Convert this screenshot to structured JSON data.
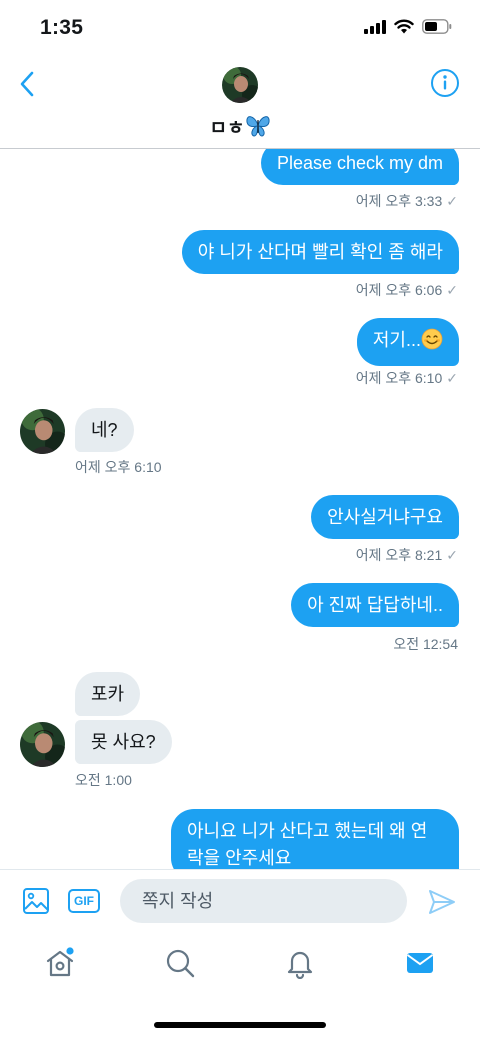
{
  "status_bar": {
    "time": "1:35"
  },
  "header": {
    "name_text": "ㅁㅎ",
    "avatar_icon": "profile-avatar",
    "back_icon": "chevron-left-icon",
    "info_icon": "info-icon"
  },
  "messages": [
    {
      "direction": "out",
      "text": "Please check my dm",
      "time": "어제 오후 3:33"
    },
    {
      "direction": "out",
      "text": "야 니가 산다며 빨리 확인 좀 해라",
      "time": "어제 오후 6:06"
    },
    {
      "direction": "out",
      "text": "저기...",
      "time": "어제 오후 6:10",
      "emoji": "smiling-face"
    },
    {
      "direction": "in",
      "text": "네?",
      "time": "어제 오후 6:10"
    },
    {
      "direction": "out",
      "text": "안사실거냐구요",
      "time": "어제 오후 8:21"
    },
    {
      "direction": "out",
      "text": "아 진짜 답답하네..",
      "time": "오전 12:54"
    },
    {
      "direction": "in",
      "text": "포카"
    },
    {
      "direction": "in",
      "text": "못 사요?",
      "time": "오전 1:00"
    },
    {
      "direction": "out",
      "text": "아니요 니가 산다고 했는데 왜 연락을 안주세요"
    }
  ],
  "composer": {
    "placeholder": "쪽지 작성",
    "gif_label": "GIF",
    "media_icon": "image-icon",
    "send_icon": "send-icon"
  },
  "tab_bar": {
    "items": [
      {
        "name": "home",
        "icon": "home-icon",
        "has_badge": true
      },
      {
        "name": "search",
        "icon": "search-icon"
      },
      {
        "name": "notifications",
        "icon": "bell-icon"
      },
      {
        "name": "messages",
        "icon": "mail-icon",
        "active": true
      }
    ]
  },
  "colors": {
    "accent": "#1da1f2",
    "incoming_bubble": "#e6ecf0",
    "meta_text": "#657786"
  }
}
